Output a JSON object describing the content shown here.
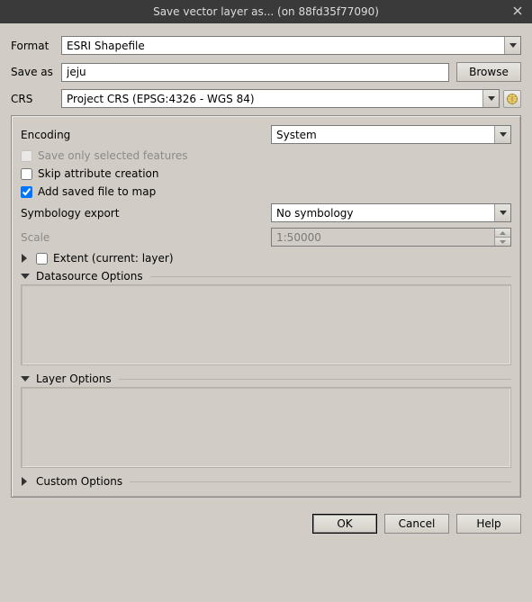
{
  "window": {
    "title": "Save vector layer as... (on 88fd35f77090)"
  },
  "form": {
    "format_label": "Format",
    "format_value": "ESRI Shapefile",
    "save_as_label": "Save as",
    "save_as_value": "jeju",
    "browse_label": "Browse",
    "crs_label": "CRS",
    "crs_value": "Project CRS (EPSG:4326 - WGS 84)"
  },
  "options": {
    "encoding_label": "Encoding",
    "encoding_value": "System",
    "save_selected_label": "Save only selected features",
    "skip_attr_label": "Skip attribute creation",
    "add_to_map_label": "Add saved file to map",
    "symbology_label": "Symbology export",
    "symbology_value": "No symbology",
    "scale_label": "Scale",
    "scale_value": "1:50000",
    "extent_label": "Extent (current: layer)",
    "datasource_label": "Datasource Options",
    "layer_options_label": "Layer Options",
    "custom_options_label": "Custom Options"
  },
  "buttons": {
    "ok": "OK",
    "cancel": "Cancel",
    "help": "Help"
  }
}
